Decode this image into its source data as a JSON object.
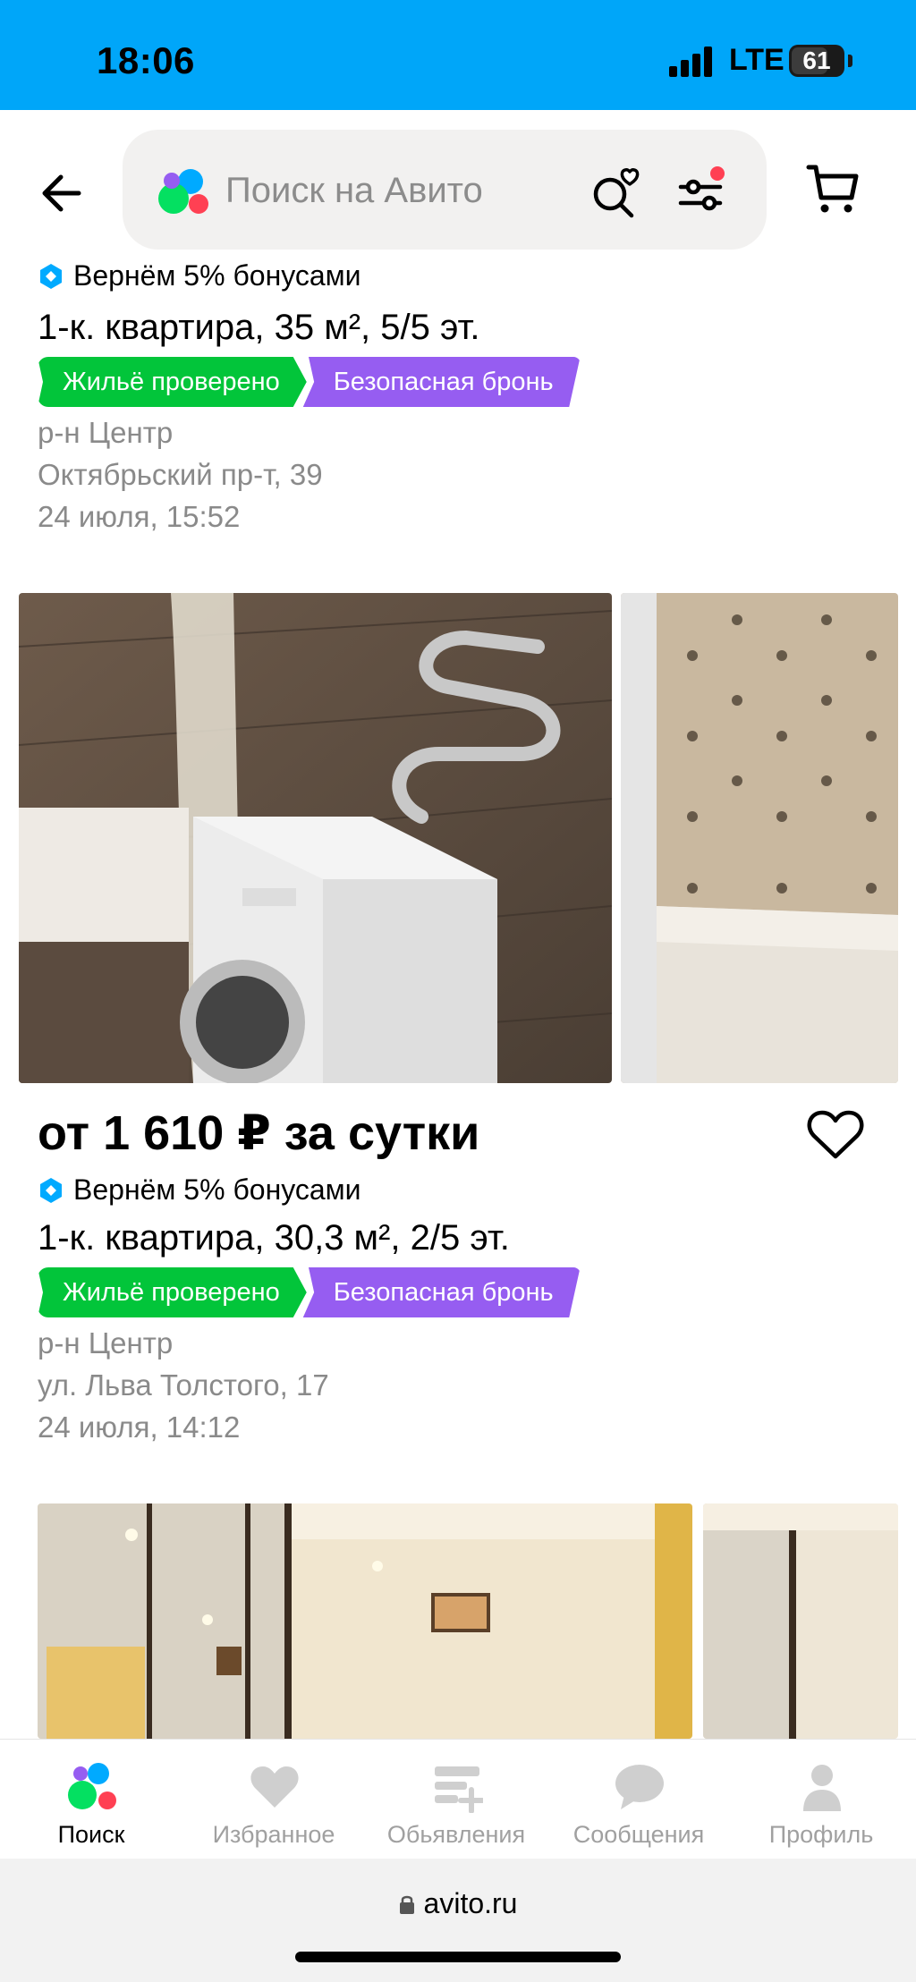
{
  "status_bar": {
    "time": "18:06",
    "network": "LTE",
    "battery": "61"
  },
  "header": {
    "search_placeholder": "Поиск на Авито"
  },
  "listings": [
    {
      "bonus": "Вернём 5% бонусами",
      "title": "1-к. квартира, 35 м², 5/5 эт.",
      "badge_verified": "Жильё проверено",
      "badge_booking": "Безопасная бронь",
      "district": "р-н Центр",
      "address": "Октябрьский пр-т, 39",
      "date": "24 июля, 15:52"
    },
    {
      "price": "от 1 610 ₽ за сутки",
      "bonus": "Вернём 5% бонусами",
      "title": "1-к. квартира, 30,3 м², 2/5 эт.",
      "badge_verified": "Жильё проверено",
      "badge_booking": "Безопасная бронь",
      "district": "р-н Центр",
      "address": "ул. Льва Толстого, 17",
      "date": "24 июля, 14:12"
    }
  ],
  "tabbar": {
    "items": [
      {
        "label": "Поиск",
        "icon": "avito-logo-icon",
        "active": true
      },
      {
        "label": "Избранное",
        "icon": "heart-icon",
        "active": false
      },
      {
        "label": "Обьявления",
        "icon": "add-listing-icon",
        "active": false
      },
      {
        "label": "Сообщения",
        "icon": "chat-bubble-icon",
        "active": false
      },
      {
        "label": "Профиль",
        "icon": "profile-icon",
        "active": false
      }
    ]
  },
  "browser": {
    "url": "avito.ru"
  },
  "colors": {
    "status_bar": "#00a6f9",
    "badge_green": "#02c53a",
    "badge_purple": "#965df1",
    "secondary_text": "#8a8a8a"
  }
}
